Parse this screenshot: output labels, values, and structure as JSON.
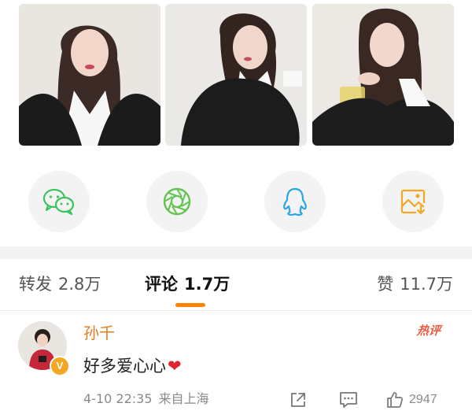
{
  "share_targets": [
    {
      "icon": "wechat-icon",
      "color": "#3cc35f"
    },
    {
      "icon": "moments-icon",
      "color": "#62c34e"
    },
    {
      "icon": "qq-icon",
      "color": "#28a6e4"
    },
    {
      "icon": "save-image-icon",
      "color": "#f5a623"
    }
  ],
  "tabs": {
    "repost": {
      "label": "转发",
      "count": "2.8万"
    },
    "comments": {
      "label": "评论",
      "count": "1.7万"
    },
    "likes": {
      "label": "赞",
      "count": "11.7万"
    }
  },
  "comment": {
    "username": "孙千",
    "badge": "热评",
    "text": "好多爱心心",
    "heart": "❤",
    "verified_mark": "V",
    "time": "4-10 22:35",
    "location": "来自上海",
    "like_count": "2947"
  },
  "colors": {
    "accent": "#ff8200",
    "username": "#e57c1d",
    "hot_badge": "#f05a41",
    "heart": "#e0262b"
  }
}
